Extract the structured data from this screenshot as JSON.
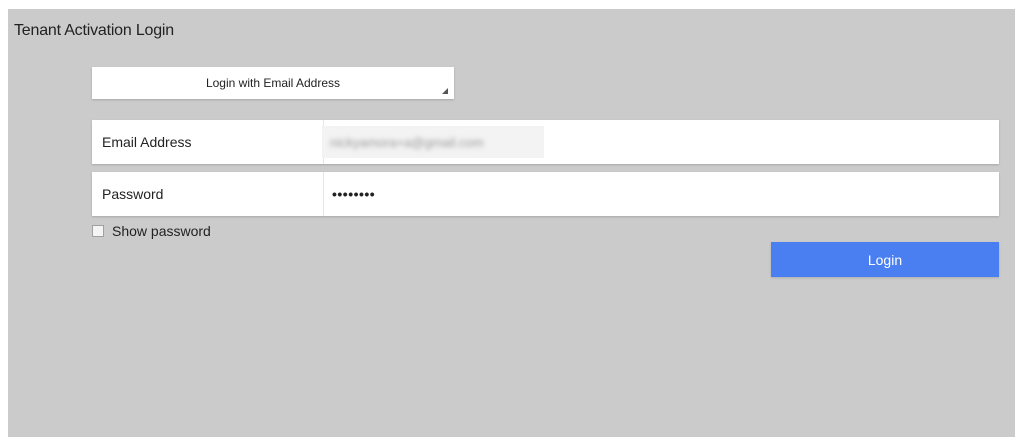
{
  "page": {
    "title": "Tenant Activation Login"
  },
  "login_method": {
    "selected": "Login with Email Address"
  },
  "email": {
    "label": "Email Address",
    "value": "nickyamora+a@gmail.com"
  },
  "password": {
    "label": "Password",
    "value": "••••••••"
  },
  "show_password": {
    "label": "Show password",
    "checked": false
  },
  "login_button": {
    "label": "Login",
    "color": "#4a7ff2"
  },
  "colors": {
    "panel_background": "#cbcbcb"
  }
}
